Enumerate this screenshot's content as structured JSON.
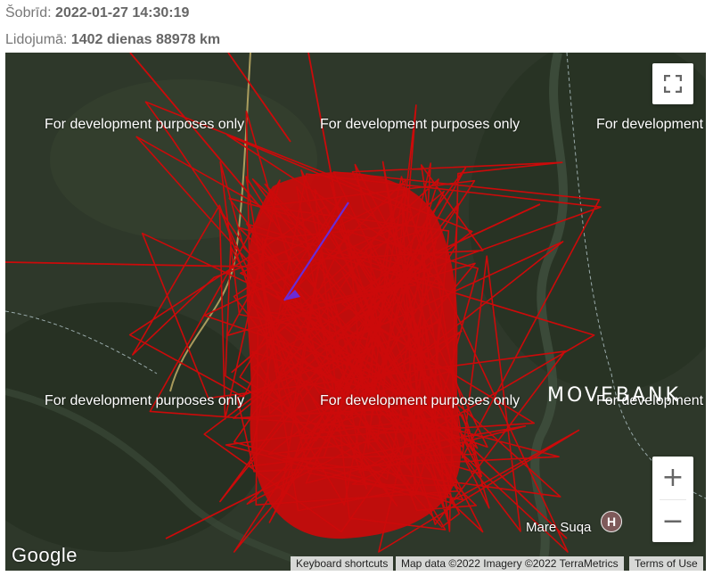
{
  "header": {
    "now_label": "Šobrīd:",
    "now_value": "2022-01-27 14:30:19",
    "flight_label": "Lidojumā:",
    "flight_value": "1402 dienas 88978 km"
  },
  "map": {
    "watermarks": [
      "For development purposes only",
      "For development purposes only",
      "For development purposes only",
      "For development purposes only",
      "For development purposes only",
      "For development purposes only"
    ],
    "brand_overlay": "MOVEBANK",
    "place_label": "Mare Suqa",
    "place_pin_letter": "H",
    "google_logo": "Google",
    "zoom_in_label": "+",
    "zoom_out_label": "−",
    "attribution": {
      "shortcuts": "Keyboard shortcuts",
      "map_data": "Map data ©2022 Imagery ©2022 TerraMetrics",
      "terms": "Terms of Use"
    },
    "colors": {
      "track": "#cc0a0a",
      "current_track": "#6a2bd6",
      "terrain": "#2f3a2b"
    }
  }
}
